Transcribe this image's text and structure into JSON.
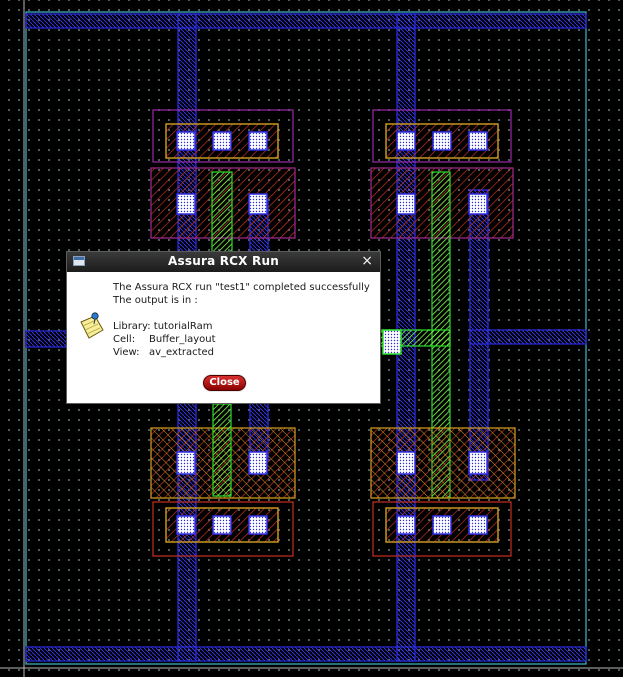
{
  "dialog": {
    "title": "Assura RCX Run",
    "close_glyph": "×",
    "window_icon": "window-app-icon",
    "message_icon": "note-pin-icon",
    "message_line1": "The Assura RCX run \"test1\" completed successfully",
    "message_line2": "The output is in :",
    "library_label": "Library:",
    "library_value": "tutorialRam",
    "cell_label": "Cell:",
    "cell_value": "Buffer_layout",
    "view_label": "View:",
    "view_value": "av_extracted",
    "close_button_label": "Close"
  },
  "layout_colors": {
    "metal1_blue": "#2a2ae0",
    "poly_green": "#2adf2a",
    "nwell_orange": "#d4a020",
    "diffusion_red": "#c83020",
    "outline_purple": "#9a2aa8",
    "cell_boundary_cyan": "#3fb8c8",
    "contact_white": "#ffffff"
  }
}
